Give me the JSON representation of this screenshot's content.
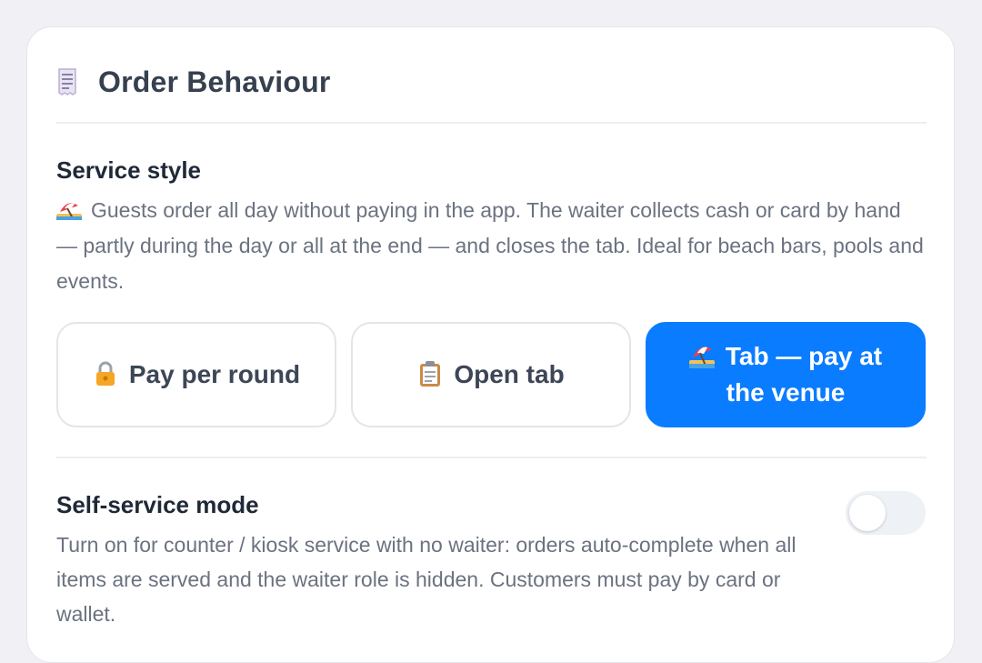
{
  "colors": {
    "accent": "#0a7cff",
    "background": "#f1f1f5",
    "card": "#ffffff",
    "title_text": "#36404f",
    "body_text": "#6b7280"
  },
  "header": {
    "icon": "receipt-icon",
    "title": "Order Behaviour"
  },
  "service_style": {
    "title": "Service style",
    "description_icon": "beach-umbrella-icon",
    "description": "Guests order all day without paying in the app. The waiter collects cash or card by hand — partly during the day or all at the end — and closes the tab. Ideal for beach bars, pools and events.",
    "options": [
      {
        "icon": "lock-icon",
        "label": "Pay per round",
        "selected": false
      },
      {
        "icon": "clipboard-icon",
        "label": "Open tab",
        "selected": false
      },
      {
        "icon": "beach-umbrella-icon",
        "label": "Tab — pay at the venue",
        "selected": true
      }
    ]
  },
  "self_service": {
    "title": "Self-service mode",
    "description": "Turn on for counter / kiosk service with no waiter: orders auto-complete when all items are served and the waiter role is hidden. Customers must pay by card or wallet.",
    "enabled": false
  }
}
